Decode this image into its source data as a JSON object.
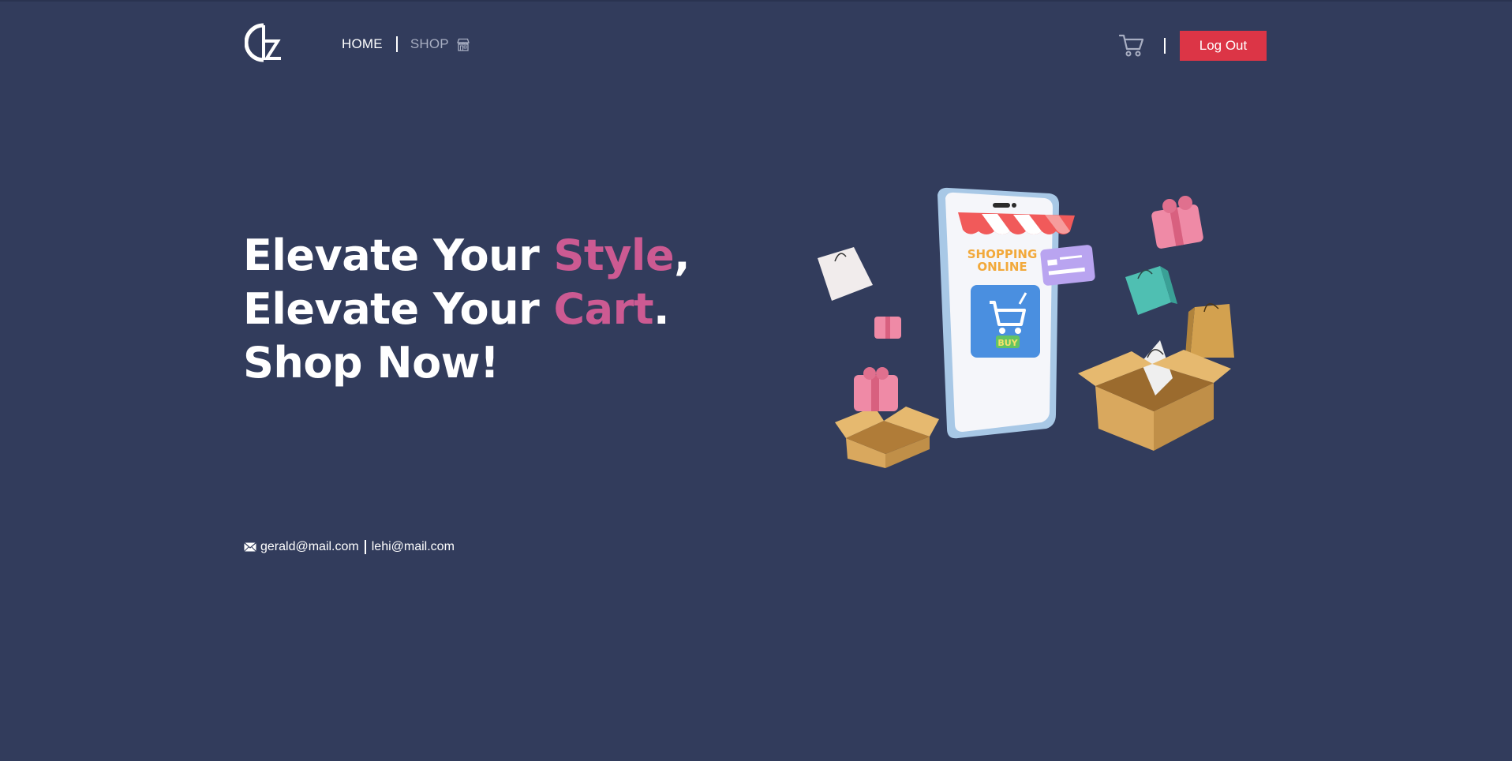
{
  "nav": {
    "home_label": "HOME",
    "shop_label": "SHOP",
    "logout_label": "Log Out"
  },
  "hero": {
    "line1_pre": "Elevate Your ",
    "line1_accent": "Style",
    "line1_post": ",",
    "line2_pre": "Elevate Your ",
    "line2_accent": "Cart",
    "line2_post": ".",
    "line3": "Shop Now!"
  },
  "illustration": {
    "sign_line1": "SHOPPING",
    "sign_line2": "ONLINE",
    "buy_label": "BUY"
  },
  "contact": {
    "email1": "gerald@mail.com",
    "email2": "lehi@mail.com"
  },
  "colors": {
    "background": "#323c5c",
    "accent": "#cc5a92",
    "logout": "#dc3546",
    "shop_link": "#a8aec2"
  },
  "icons": {
    "logo": "logo-icon",
    "shop": "store-icon",
    "cart": "cart-icon",
    "mail": "mail-icon"
  }
}
